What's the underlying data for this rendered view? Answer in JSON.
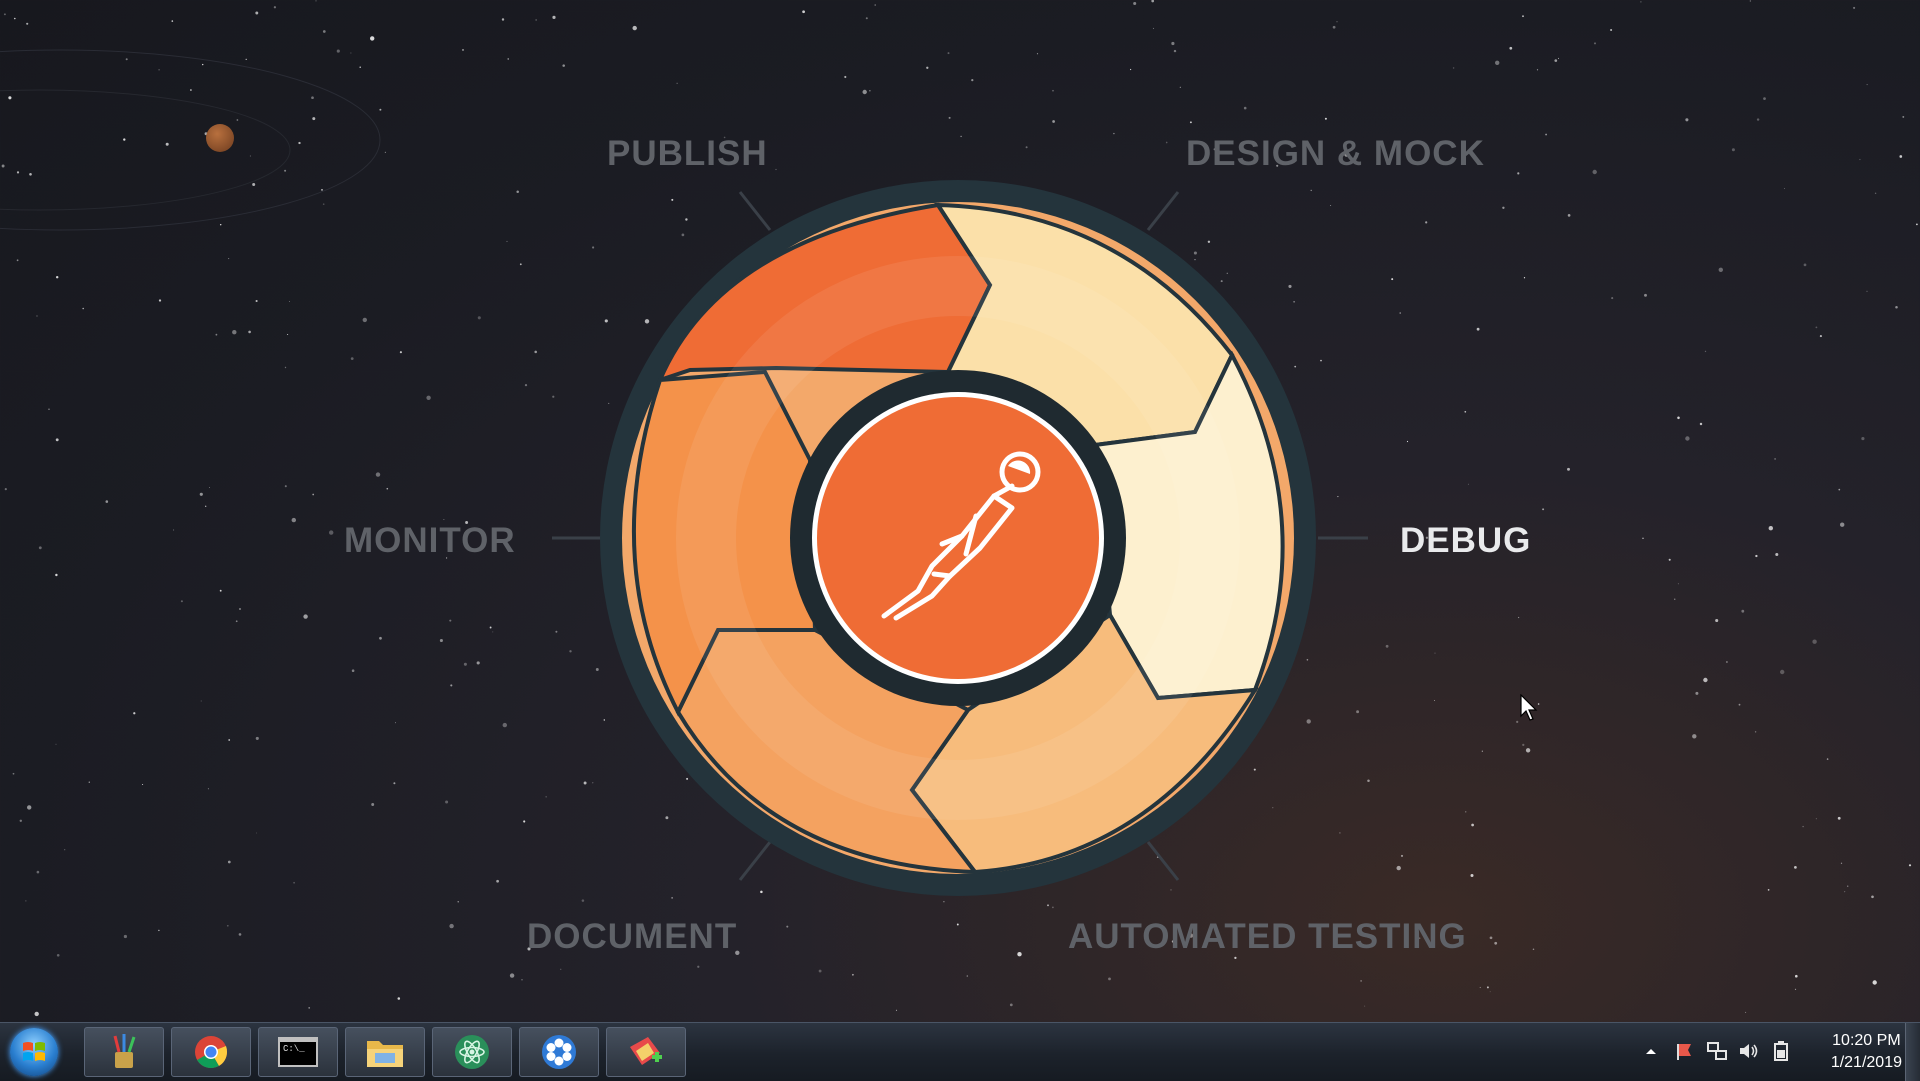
{
  "cycle": {
    "labels": {
      "publish": "PUBLISH",
      "design_mock": "DESIGN & MOCK",
      "monitor": "MONITOR",
      "debug": "DEBUG",
      "document": "DOCUMENT",
      "automated_testing": "AUTOMATED TESTING"
    },
    "active": "DEBUG",
    "center_icon": "postman-astronaut-logo",
    "colors": {
      "accent": "#ef6c35",
      "ring": "#24343c",
      "label_inactive": "#5f6268",
      "label_active": "#e9eaec"
    }
  },
  "taskbar": {
    "start_icon": "windows-start-orb",
    "pinned": [
      {
        "name": "paint-brushes-icon"
      },
      {
        "name": "chrome-icon"
      },
      {
        "name": "command-prompt-icon",
        "text": "C:\\_"
      },
      {
        "name": "file-explorer-icon"
      },
      {
        "name": "atom-editor-icon"
      },
      {
        "name": "settings-flower-icon"
      },
      {
        "name": "create-shortcut-icon"
      }
    ],
    "tray_icons": [
      "show-hidden-icons-arrow",
      "flag-icon",
      "network-icon",
      "volume-icon",
      "power-icon"
    ],
    "clock": {
      "time": "10:20 PM",
      "date": "1/21/2019"
    }
  }
}
